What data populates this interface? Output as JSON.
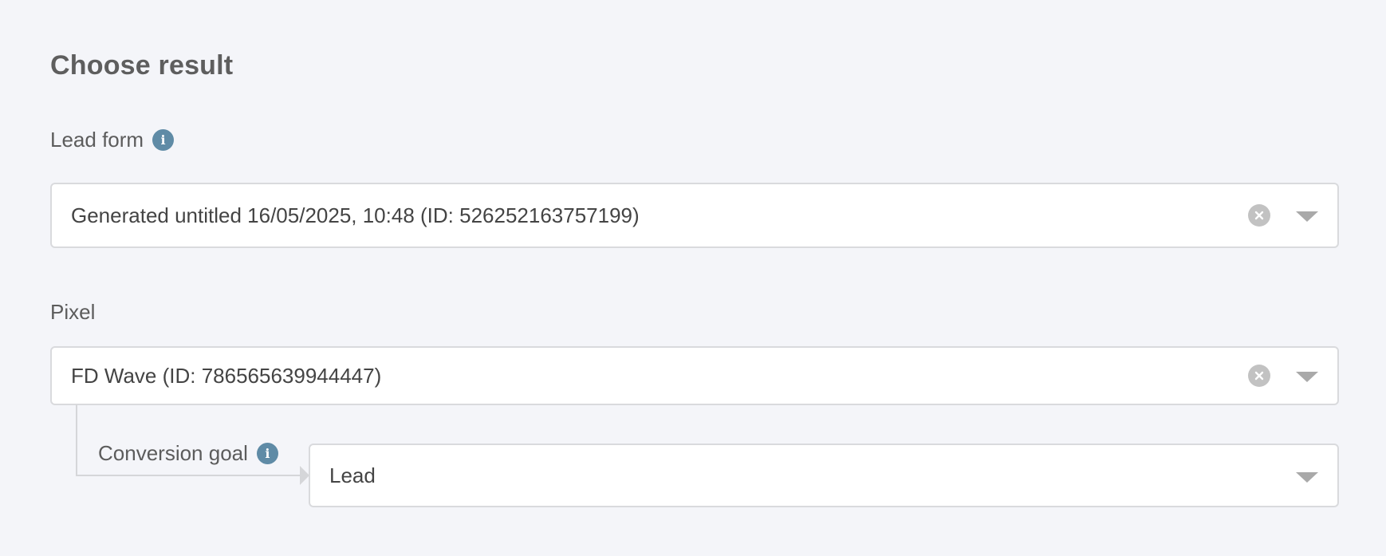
{
  "section": {
    "title": "Choose result"
  },
  "lead_form": {
    "label": "Lead form",
    "info_icon": "info-icon",
    "selected_value": "Generated untitled 16/05/2025, 10:48 (ID: 526252163757199)",
    "clear_icon": "clear-icon",
    "caret_icon": "chevron-down-icon"
  },
  "pixel": {
    "label": "Pixel",
    "selected_value": "FD Wave (ID: 786565639944447)",
    "clear_icon": "clear-icon",
    "caret_icon": "chevron-down-icon"
  },
  "conversion_goal": {
    "label": "Conversion goal",
    "info_icon": "info-icon",
    "selected_value": "Lead",
    "caret_icon": "chevron-down-icon"
  },
  "colors": {
    "background": "#f4f5f9",
    "info_icon": "#5f8ba6",
    "border": "#d9dadd",
    "clear_icon": "#c2c2c2",
    "caret": "#a9a9a9"
  }
}
